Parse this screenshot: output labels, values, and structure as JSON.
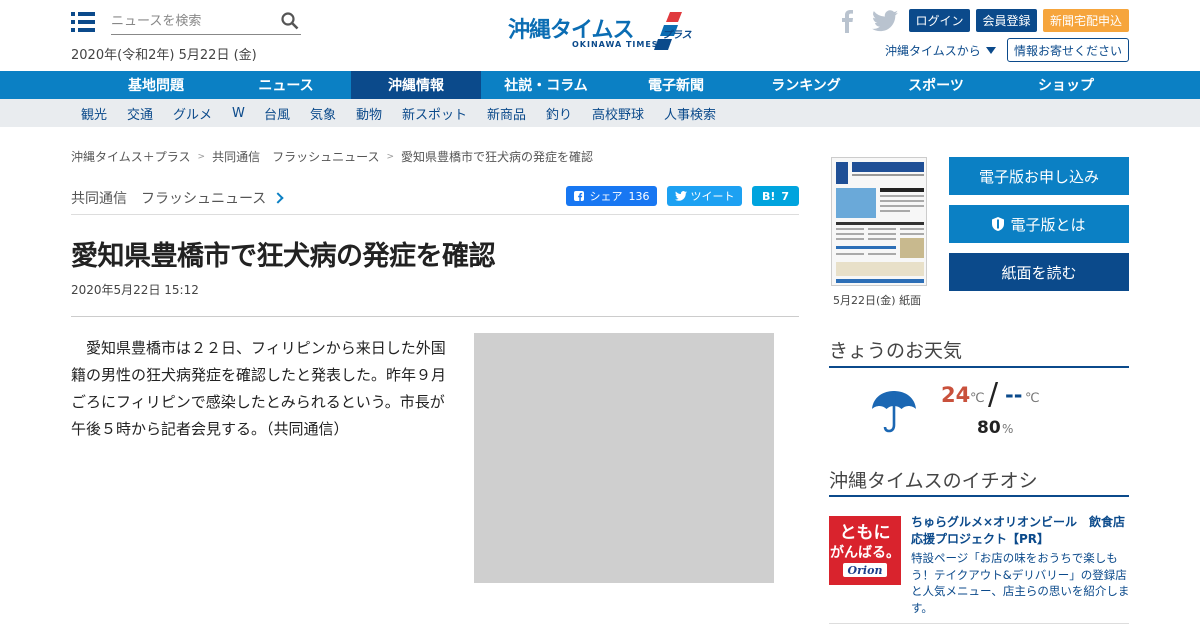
{
  "header": {
    "search_placeholder": "ニュースを検索",
    "date": "2020年(令和2年) 5月22日 (金)",
    "logo_jp": "沖縄タイムス",
    "logo_en": "OKINAWA TIMES",
    "logo_plus": "プラス",
    "login": "ログイン",
    "member": "会員登録",
    "delivery": "新聞宅配申込",
    "from_link": "沖縄タイムスから",
    "info_button": "情報お寄せください"
  },
  "nav": {
    "main": [
      "基地問題",
      "ニュース",
      "沖縄情報",
      "社説・コラム",
      "電子新聞",
      "ランキング",
      "スポーツ",
      "ショップ"
    ],
    "active_index": 2,
    "sub": [
      "観光",
      "交通",
      "グルメ",
      "W",
      "台風",
      "気象",
      "動物",
      "新スポット",
      "新商品",
      "釣り",
      "高校野球",
      "人事検索"
    ]
  },
  "breadcrumb": [
    "沖縄タイムス＋プラス",
    "共同通信　フラッシュニュース",
    "愛知県豊橋市で狂犬病の発症を確認"
  ],
  "article": {
    "category": "共同通信　フラッシュニュース",
    "share_fb_label": "シェア",
    "share_fb_count": "136",
    "share_tw_label": "ツイート",
    "share_hb_label": "B!",
    "share_hb_count": "7",
    "title": "愛知県豊橋市で狂犬病の発症を確認",
    "date": "2020年5月22日 15:12",
    "body": "　愛知県豊橋市は２２日、フィリピンから来日した外国籍の男性の狂犬病発症を確認したと発表した。昨年９月ごろにフィリピンで感染したとみられるという。市長が午後５時から記者会見する。（共同通信）"
  },
  "sidebar": {
    "paper_caption": "5月22日(金) 紙面",
    "btn_apply": "電子版お申し込み",
    "btn_about": "電子版とは",
    "btn_read": "紙面を読む",
    "weather_heading": "きょうのお天気",
    "weather_icon": "umbrella-icon",
    "temp_high": "24",
    "temp_low": "--",
    "temp_unit": "℃",
    "rain_chance": "80",
    "rain_unit": "%",
    "pick_heading": "沖縄タイムスのイチオシ",
    "pick_img_text1": "ともに",
    "pick_img_text2": "がんばる。",
    "pick_img_brand": "Orion",
    "pick_title": "ちゅらグルメ×オリオンビール　飲食店応援プロジェクト【PR】",
    "pick_desc": "特設ページ「お店の味をおうちで楽しもう！テイクアウト&デリバリー」の登録店と人気メニュー、店主らの思いを紹介します。"
  },
  "colors": {
    "brand_dark": "#0b4a8b",
    "brand_light": "#0b80c4",
    "accent_orange": "#f6a53c",
    "temp_high": "#c9513c"
  }
}
